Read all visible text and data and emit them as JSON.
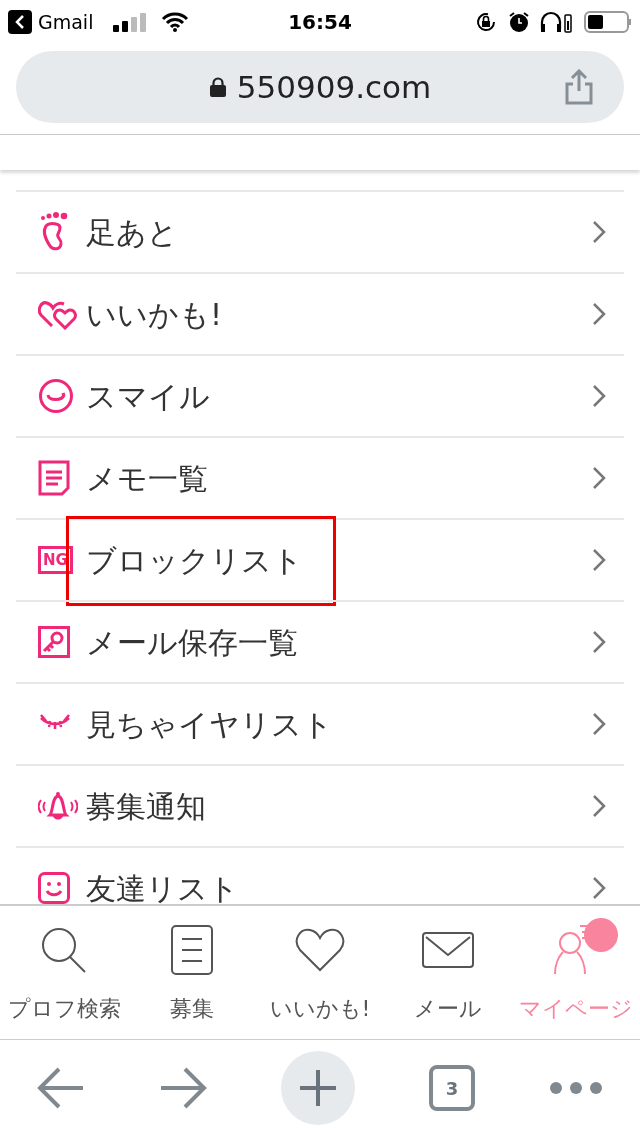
{
  "status_bar": {
    "back_app": "Gmail",
    "time": "16:54"
  },
  "address_bar": {
    "url": "550909.com"
  },
  "menu": [
    {
      "kind": "footprint",
      "label": "足あと",
      "highlighted": false
    },
    {
      "kind": "hearts",
      "label": "いいかも!",
      "highlighted": false
    },
    {
      "kind": "smile",
      "label": "スマイル",
      "highlighted": false
    },
    {
      "kind": "memo",
      "label": "メモ一覧",
      "highlighted": false
    },
    {
      "kind": "ng",
      "badge": "NG",
      "label": "ブロックリスト",
      "highlighted": true
    },
    {
      "kind": "key",
      "label": "メール保存一覧",
      "highlighted": false
    },
    {
      "kind": "eye",
      "label": "見ちゃイヤリスト",
      "highlighted": false
    },
    {
      "kind": "bell",
      "label": "募集通知",
      "highlighted": false
    },
    {
      "kind": "face",
      "label": "友達リスト",
      "highlighted": false
    }
  ],
  "tab_bar": [
    {
      "kind": "search",
      "label": "プロフ検索",
      "selected": false
    },
    {
      "kind": "list",
      "label": "募集",
      "selected": false
    },
    {
      "kind": "heart",
      "label": "いいかも!",
      "selected": false
    },
    {
      "kind": "mail",
      "label": "メール",
      "selected": false
    },
    {
      "kind": "person",
      "label": "マイページ",
      "selected": true,
      "notification": true
    }
  ],
  "browser_toolbar": {
    "tab_count": "3"
  }
}
